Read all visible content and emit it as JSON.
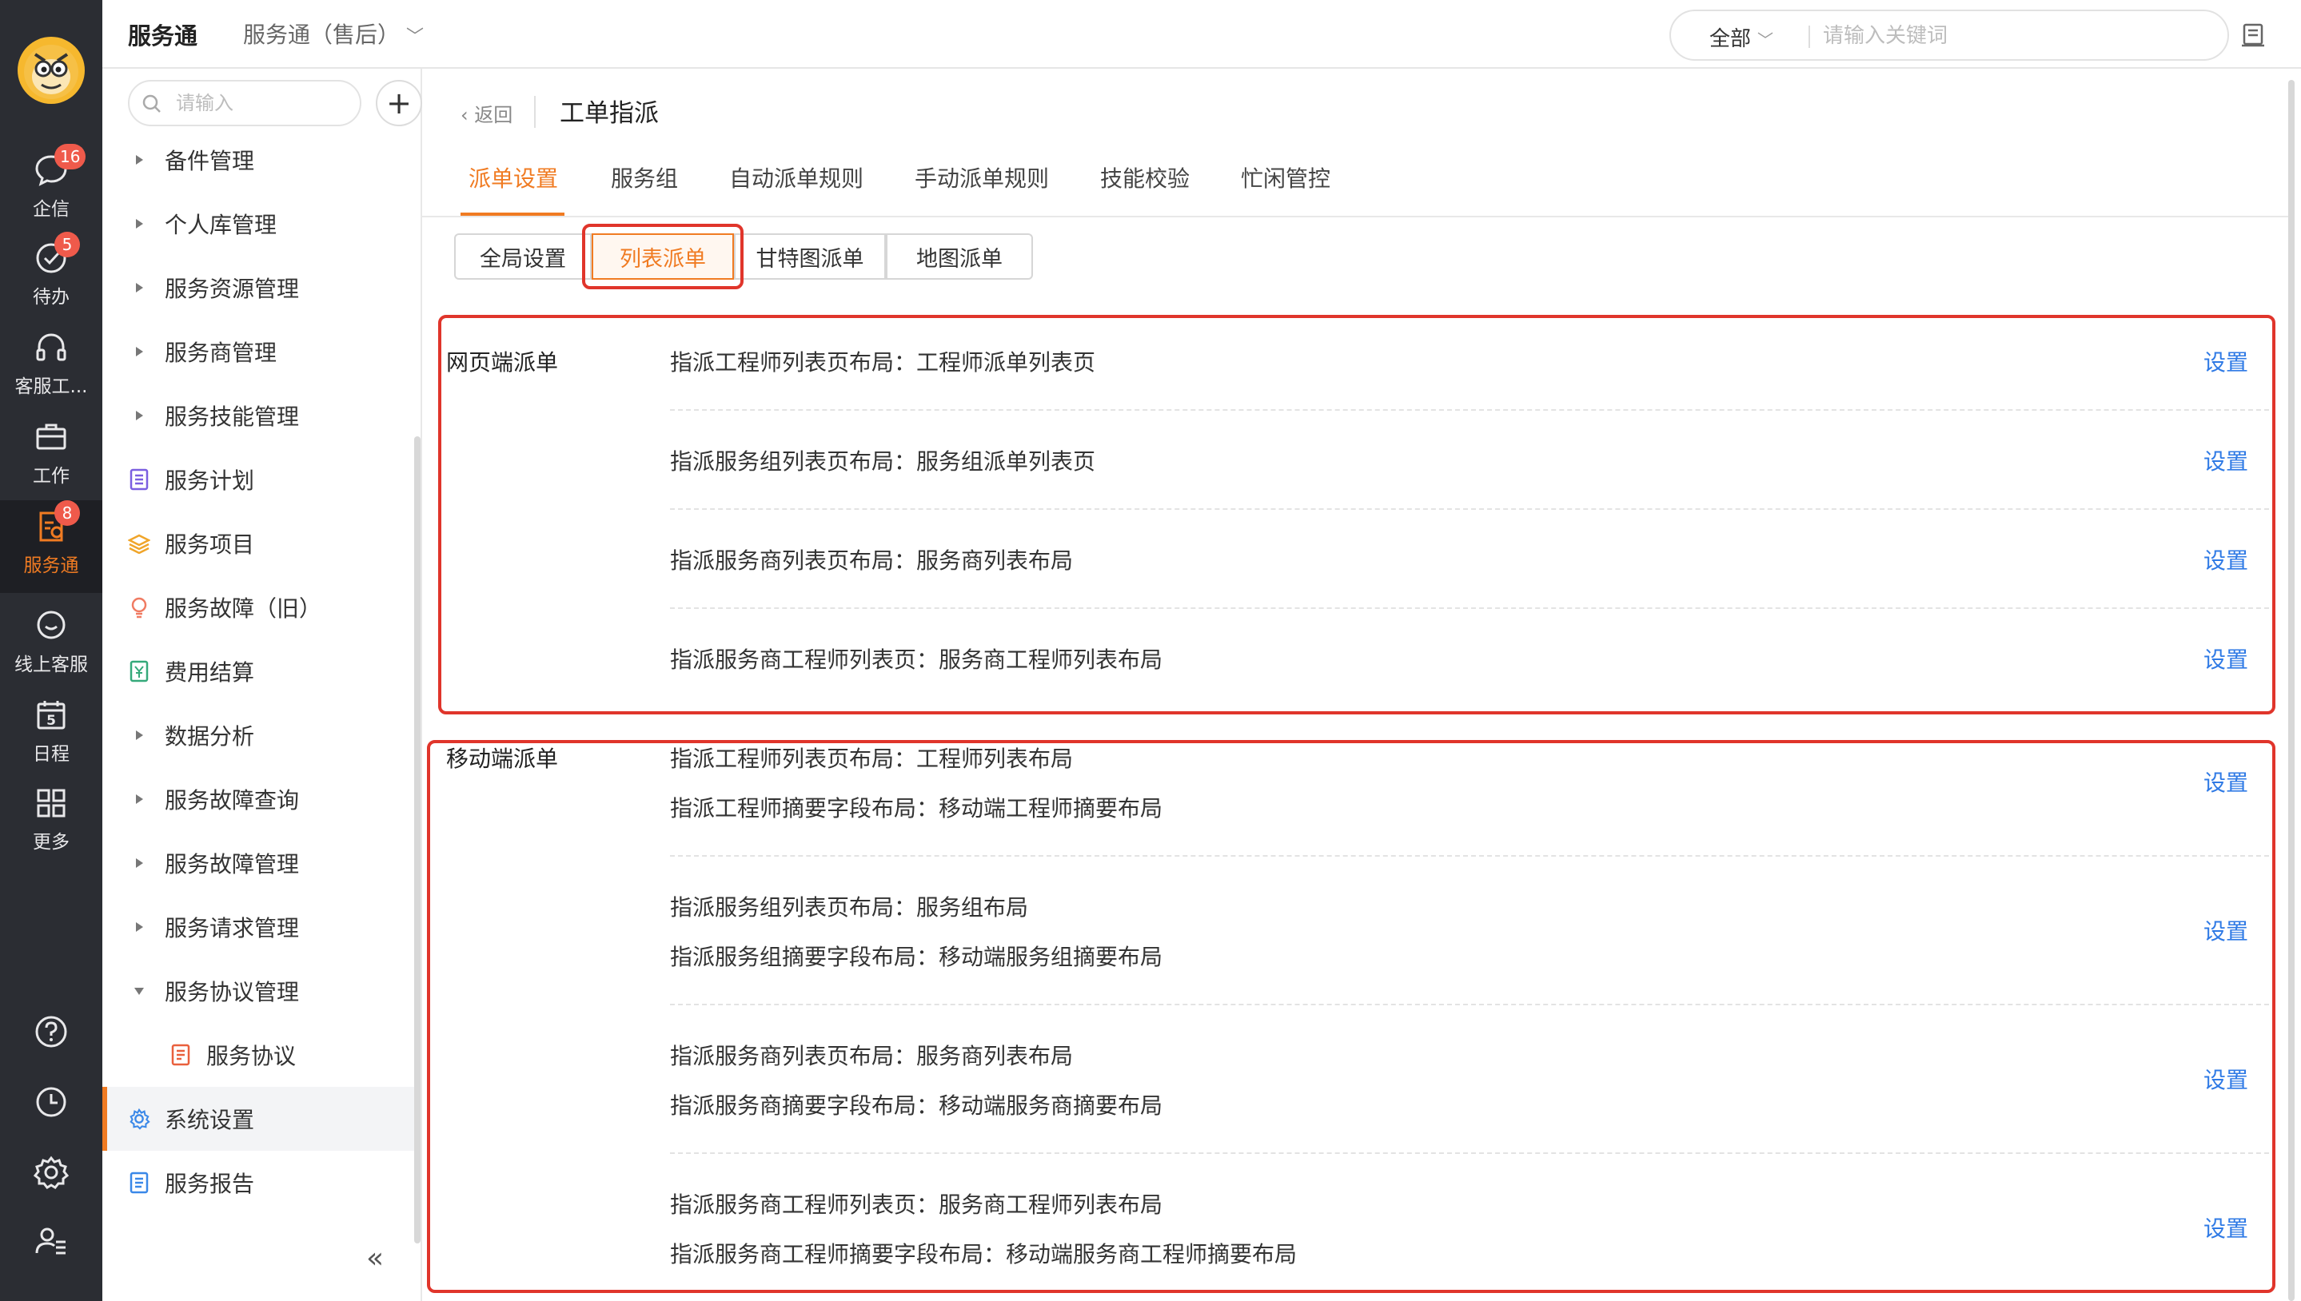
{
  "rail": {
    "items": [
      {
        "label": "企信",
        "badge": "16"
      },
      {
        "label": "待办",
        "badge": "5"
      },
      {
        "label": "客服工...",
        "badge": ""
      },
      {
        "label": "工作",
        "badge": ""
      },
      {
        "label": "服务通",
        "badge": "8"
      },
      {
        "label": "线上客服",
        "badge": ""
      },
      {
        "label": "日程",
        "badge": ""
      },
      {
        "label": "更多",
        "badge": ""
      }
    ],
    "calendar_day": "5",
    "active_color": "#f07b22"
  },
  "header": {
    "app_title": "服务通",
    "app_switch": "服务通（售后）",
    "search_scope": "全部",
    "search_placeholder": "请输入关键词"
  },
  "sidebar": {
    "search_placeholder": "请输入",
    "add_label": "+",
    "items": [
      {
        "label": "备件管理"
      },
      {
        "label": "个人库管理"
      },
      {
        "label": "服务资源管理"
      },
      {
        "label": "服务商管理"
      },
      {
        "label": "服务技能管理"
      },
      {
        "label": "服务计划"
      },
      {
        "label": "服务项目"
      },
      {
        "label": "服务故障（旧）"
      },
      {
        "label": "费用结算"
      },
      {
        "label": "数据分析"
      },
      {
        "label": "服务故障查询"
      },
      {
        "label": "服务故障管理"
      },
      {
        "label": "服务请求管理"
      },
      {
        "label": "服务协议管理"
      },
      {
        "label": "服务协议"
      },
      {
        "label": "系统设置"
      },
      {
        "label": "服务报告"
      }
    ],
    "collapse_label": "«"
  },
  "main": {
    "back_label": "返回",
    "title": "工单指派",
    "tabs": [
      {
        "label": "派单设置"
      },
      {
        "label": "服务组"
      },
      {
        "label": "自动派单规则"
      },
      {
        "label": "手动派单规则"
      },
      {
        "label": "技能校验"
      },
      {
        "label": "忙闲管控"
      }
    ],
    "subtabs": [
      {
        "label": "全局设置"
      },
      {
        "label": "列表派单"
      },
      {
        "label": "甘特图派单"
      },
      {
        "label": "地图派单"
      }
    ],
    "web_section": {
      "title": "网页端派单",
      "rows": [
        {
          "line": "指派工程师列表页布局：工程师派单列表页",
          "action": "设置"
        },
        {
          "line": "指派服务组列表页布局：服务组派单列表页",
          "action": "设置"
        },
        {
          "line": "指派服务商列表页布局：服务商列表布局",
          "action": "设置"
        },
        {
          "line": "指派服务商工程师列表页：服务商工程师列表布局",
          "action": "设置"
        }
      ]
    },
    "mobile_section": {
      "title": "移动端派单",
      "rows": [
        {
          "line1": "指派工程师列表页布局：工程师列表布局",
          "line2": "指派工程师摘要字段布局：移动端工程师摘要布局",
          "action": "设置"
        },
        {
          "line1": "指派服务组列表页布局：服务组布局",
          "line2": "指派服务组摘要字段布局：移动端服务组摘要布局",
          "action": "设置"
        },
        {
          "line1": "指派服务商列表页布局：服务商列表布局",
          "line2": "指派服务商摘要字段布局：移动端服务商摘要布局",
          "action": "设置"
        },
        {
          "line1": "指派服务商工程师列表页：服务商工程师列表布局",
          "line2": "指派服务商工程师摘要字段布局：移动端服务商工程师摘要布局",
          "action": "设置"
        }
      ]
    }
  }
}
